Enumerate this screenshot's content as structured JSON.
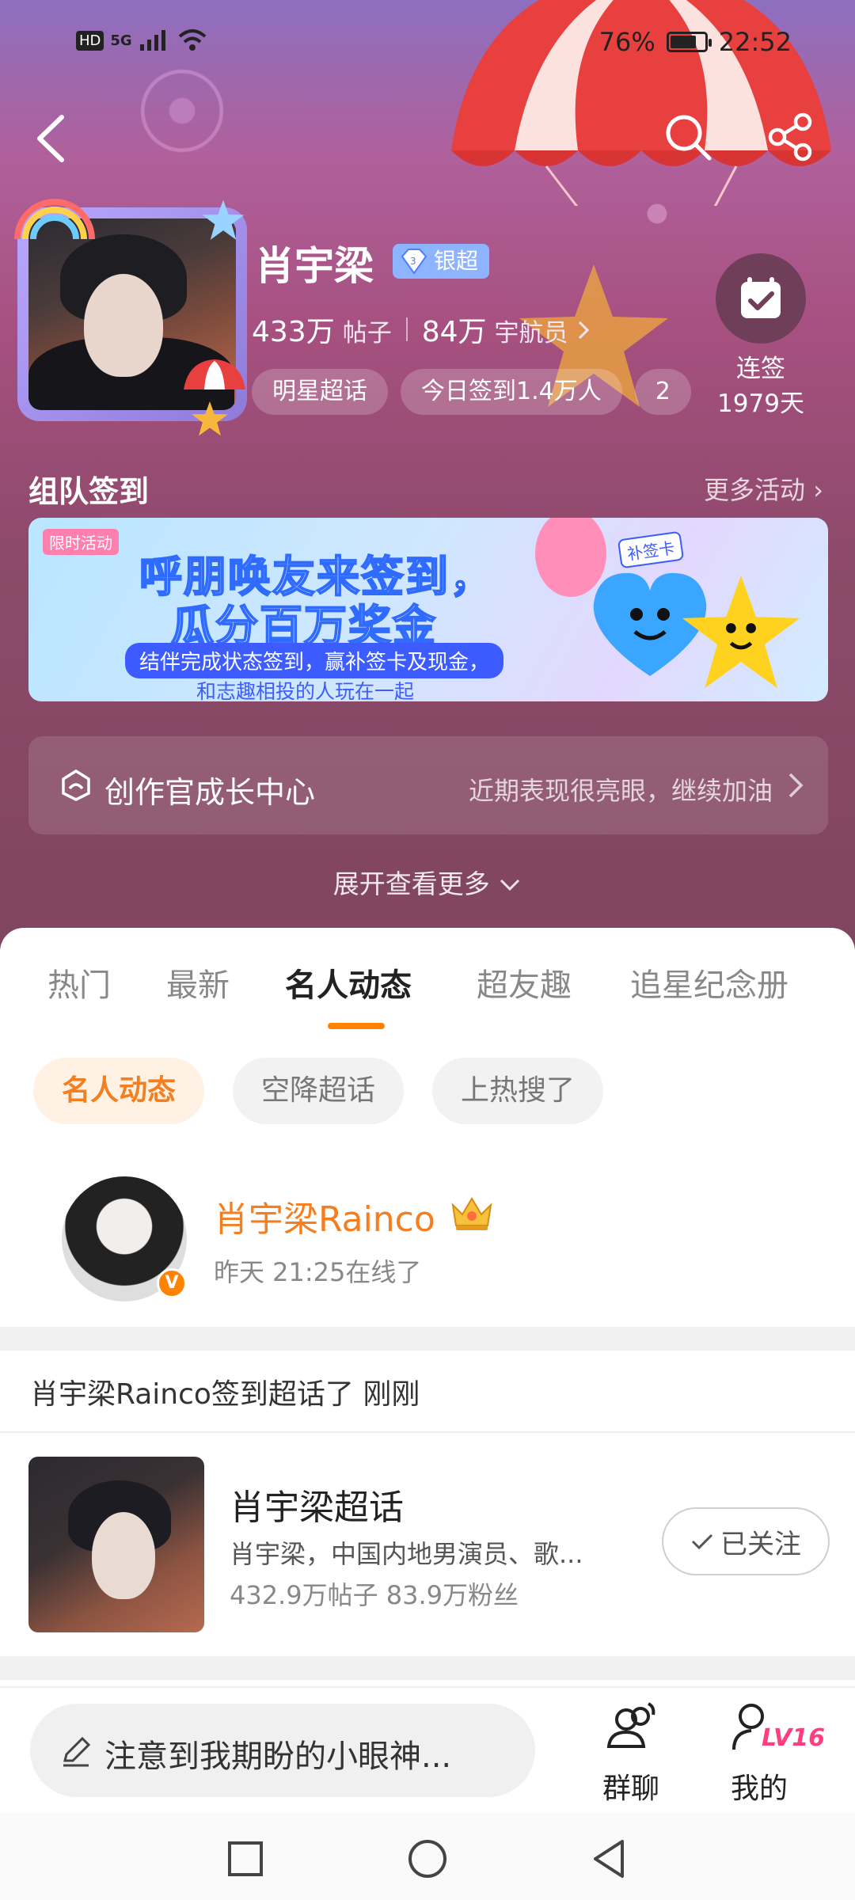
{
  "status_bar": {
    "left_icons": [
      "HD",
      "5G"
    ],
    "battery": "76%",
    "battery_level": 0.76,
    "time": "22:52"
  },
  "header": {
    "back_icon": "back-arrow-icon",
    "search_icon": "search-icon",
    "share_icon": "share-icon"
  },
  "topic": {
    "name": "肖宇梁",
    "rank_badge": "银超",
    "posts_num": "433万",
    "posts_unit": "帖子",
    "members_num": "84万",
    "members_unit": "宇航员",
    "chips": [
      "明星超话",
      "今日签到1.4万人",
      "2"
    ],
    "checkin_label": "连签",
    "checkin_days": "1979天"
  },
  "team_checkin": {
    "title": "组队签到",
    "more": "更多活动",
    "banner": {
      "tag": "限时活动",
      "line1": "呼朋唤友来签到，",
      "line2": "瓜分百万奖金",
      "sub1": "结伴完成状态签到，赢补签卡及现金，",
      "sub2": "和志趣相投的人玩在一起",
      "card_label": "补签卡"
    }
  },
  "creator": {
    "title": "创作官成长中心",
    "note": "近期表现很亮眼，继续加油"
  },
  "expand_label": "展开查看更多",
  "tabs": [
    "热门",
    "最新",
    "名人动态",
    "超友趣",
    "追星纪念册"
  ],
  "active_tab": "名人动态",
  "filters": [
    "名人动态",
    "空降超话",
    "上热搜了"
  ],
  "celebrity": {
    "name": "肖宇梁Rainco",
    "status": "昨天 21:25在线了",
    "verified_badge": "V"
  },
  "activity": {
    "line": "肖宇梁Rainco签到超话了 刚刚",
    "card": {
      "title": "肖宇梁超话",
      "desc": "肖宇梁，中国内地男演员、歌...",
      "stats": "432.9万帖子  83.9万粉丝",
      "follow_label": "已关注"
    }
  },
  "bottom_bar": {
    "comment_placeholder": "注意到我期盼的小眼神...",
    "group_chat": "群聊",
    "mine": "我的",
    "level": "LV16"
  },
  "colors": {
    "accent": "#ff8200",
    "name_orange": "#f47e20",
    "badge_blue": "#8fb4ff",
    "level_pink": "#ff3d7f"
  }
}
